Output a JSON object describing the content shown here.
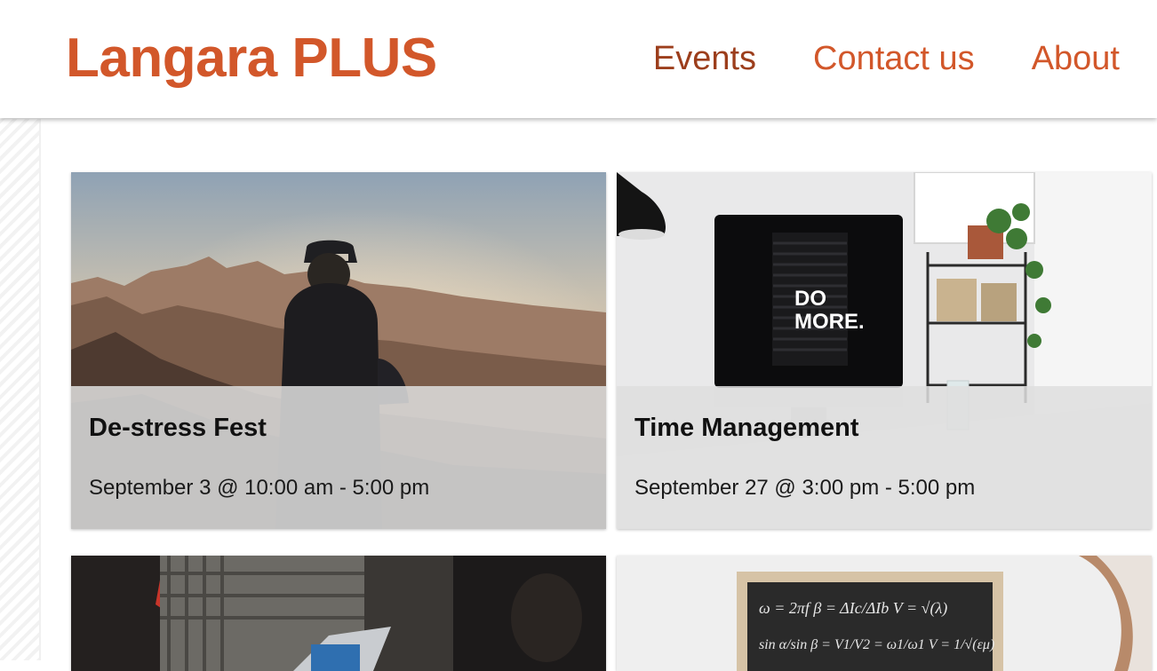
{
  "header": {
    "logo": "Langara PLUS",
    "nav": [
      {
        "label": "Events"
      },
      {
        "label": "Contact us"
      },
      {
        "label": "About"
      }
    ]
  },
  "events": [
    {
      "title": "De-stress Fest",
      "date": "September 3 @ 10:00 am - 5:00 pm",
      "image": "person-on-mountain-sunset"
    },
    {
      "title": "Time Management",
      "date": "September 27 @ 3:00 pm - 5:00 pm",
      "image": "desk-computer-do-more"
    },
    {
      "image": "group-with-laptop"
    },
    {
      "image": "chalkboard-formulas"
    }
  ],
  "chalkboard_lines": [
    "ω = 2πf  β = ΔIc/ΔIb  V = √(λ)",
    "sin α/sin β = V1/V2 = ω1/ω1  V = 1/√(εμ)"
  ],
  "monitor_text": [
    "DO",
    "MORE."
  ],
  "colors": {
    "brand": "#d2572a",
    "nav_active": "#9c3e1c"
  }
}
